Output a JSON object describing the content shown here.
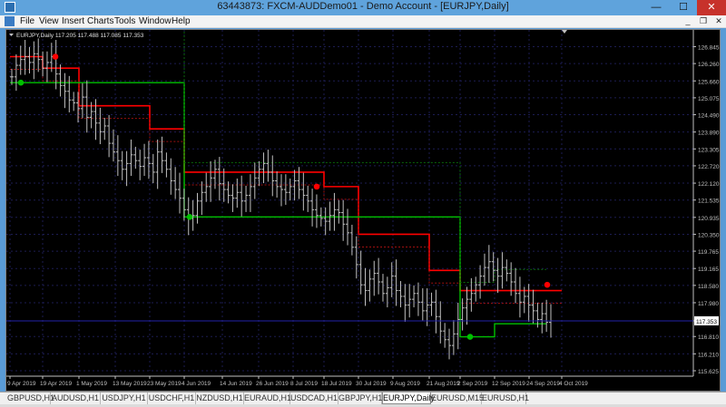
{
  "window": {
    "title": "63443873: FXCM-AUDDemo01 - Demo Account - [EURJPY,Daily]",
    "buttons": {
      "minimize": "—",
      "maximize": "☐",
      "close": "✕"
    }
  },
  "menu": {
    "items": [
      "File",
      "View",
      "Insert",
      "Charts",
      "Tools",
      "Window",
      "Help"
    ]
  },
  "mdi": {
    "minimize": "_",
    "restore": "❐",
    "close": "✕"
  },
  "chart": {
    "info_line": "EURJPY,Daily  117.205 117.488 117.085 117.353",
    "current_price": "117.353",
    "colors": {
      "background": "#000000",
      "candle": "#c0c0c0",
      "grid": "#1c1c52",
      "resistance": "#ff0000",
      "support": "#00c000",
      "price_line": "#2222aa"
    }
  },
  "chart_data": {
    "type": "candlestick",
    "symbol": "EURJPY",
    "timeframe": "Daily",
    "ohlc_last": {
      "open": 117.205,
      "high": 117.488,
      "low": 117.085,
      "close": 117.353
    },
    "ylim": [
      115.625,
      127.3
    ],
    "y_ticks": [
      "126.845",
      "126.260",
      "125.660",
      "125.075",
      "124.490",
      "123.890",
      "123.305",
      "122.720",
      "122.120",
      "121.535",
      "120.935",
      "120.350",
      "119.765",
      "119.165",
      "118.580",
      "117.980",
      "117.353",
      "116.810",
      "116.210",
      "115.625"
    ],
    "x_ticks": [
      "9 Apr 2019",
      "19 Apr 2019",
      "1 May 2019",
      "13 May 2019",
      "23 May 2019",
      "4 Jun 2019",
      "14 Jun 2019",
      "26 Jun 2019",
      "8 Jul 2019",
      "18 Jul 2019",
      "30 Jul 2019",
      "9 Aug 2019",
      "21 Aug 2019",
      "2 Sep 2019",
      "12 Sep 2019",
      "24 Sep 2019",
      "4 Oct 2019"
    ],
    "closes": [
      125.8,
      126.2,
      126.4,
      126.5,
      126.3,
      126.6,
      126.4,
      126.1,
      126.3,
      126.5,
      125.9,
      125.5,
      125.3,
      125.0,
      124.9,
      124.7,
      125.1,
      124.4,
      124.6,
      124.2,
      123.9,
      124.1,
      123.5,
      123.2,
      122.9,
      122.6,
      122.8,
      123.1,
      122.9,
      122.7,
      123.0,
      122.8,
      122.5,
      123.2,
      122.9,
      122.6,
      122.2,
      121.9,
      121.6,
      121.2,
      120.9,
      121.0,
      121.5,
      121.8,
      122.0,
      122.3,
      122.6,
      122.1,
      121.9,
      121.7,
      121.6,
      121.8,
      121.5,
      121.7,
      122.0,
      122.3,
      122.6,
      122.8,
      122.5,
      122.2,
      122.0,
      121.9,
      121.8,
      122.0,
      122.2,
      121.9,
      121.7,
      121.5,
      121.2,
      121.0,
      120.9,
      120.8,
      121.0,
      121.2,
      121.1,
      120.7,
      120.4,
      119.9,
      119.3,
      118.6,
      118.4,
      118.8,
      119.0,
      118.7,
      118.3,
      118.5,
      118.9,
      118.4,
      118.2,
      117.9,
      118.1,
      118.3,
      118.0,
      117.7,
      117.9,
      118.0,
      117.5,
      117.0,
      116.7,
      116.5,
      116.9,
      117.4,
      117.8,
      118.1,
      118.3,
      118.6,
      118.9,
      119.2,
      119.4,
      119.1,
      118.9,
      119.2,
      119.0,
      118.7,
      118.3,
      118.0,
      118.2,
      117.9,
      117.7,
      117.4,
      117.6,
      117.3,
      117.353
    ],
    "resistance_levels": [
      {
        "from": "9 Apr 2019",
        "value": 126.5
      },
      {
        "from": "19 Apr 2019",
        "value": 126.1
      },
      {
        "from": "1 May 2019",
        "value": 124.8
      },
      {
        "from": "23 May 2019",
        "value": 124.0
      },
      {
        "from": "4 Jun 2019",
        "value": 122.5
      },
      {
        "from": "18 Jul 2019",
        "value": 122.0
      },
      {
        "from": "30 Jul 2019",
        "value": 120.35
      },
      {
        "from": "21 Aug 2019",
        "value": 119.1
      },
      {
        "from": "2 Sep 2019",
        "value": 118.4
      }
    ],
    "support_levels": [
      {
        "from": "9 Apr 2019",
        "value": 125.6
      },
      {
        "from": "4 Jun 2019",
        "value": 120.95
      },
      {
        "from": "2 Sep 2019",
        "value": 116.8
      },
      {
        "from": "12 Sep 2019",
        "value": 117.25
      }
    ],
    "grid": true
  },
  "tabs": {
    "items": [
      "GBPUSD,H1",
      "AUDUSD,H1",
      "USDJPY,H1",
      "USDCHF,H1",
      "NZDUSD,H1",
      "EURAUD,H1",
      "USDCAD,H1",
      "GBPJPY,H1",
      "EURJPY,Daily",
      "EURUSD,M15",
      "EURUSD,H1"
    ],
    "active": "EURJPY,Daily"
  }
}
